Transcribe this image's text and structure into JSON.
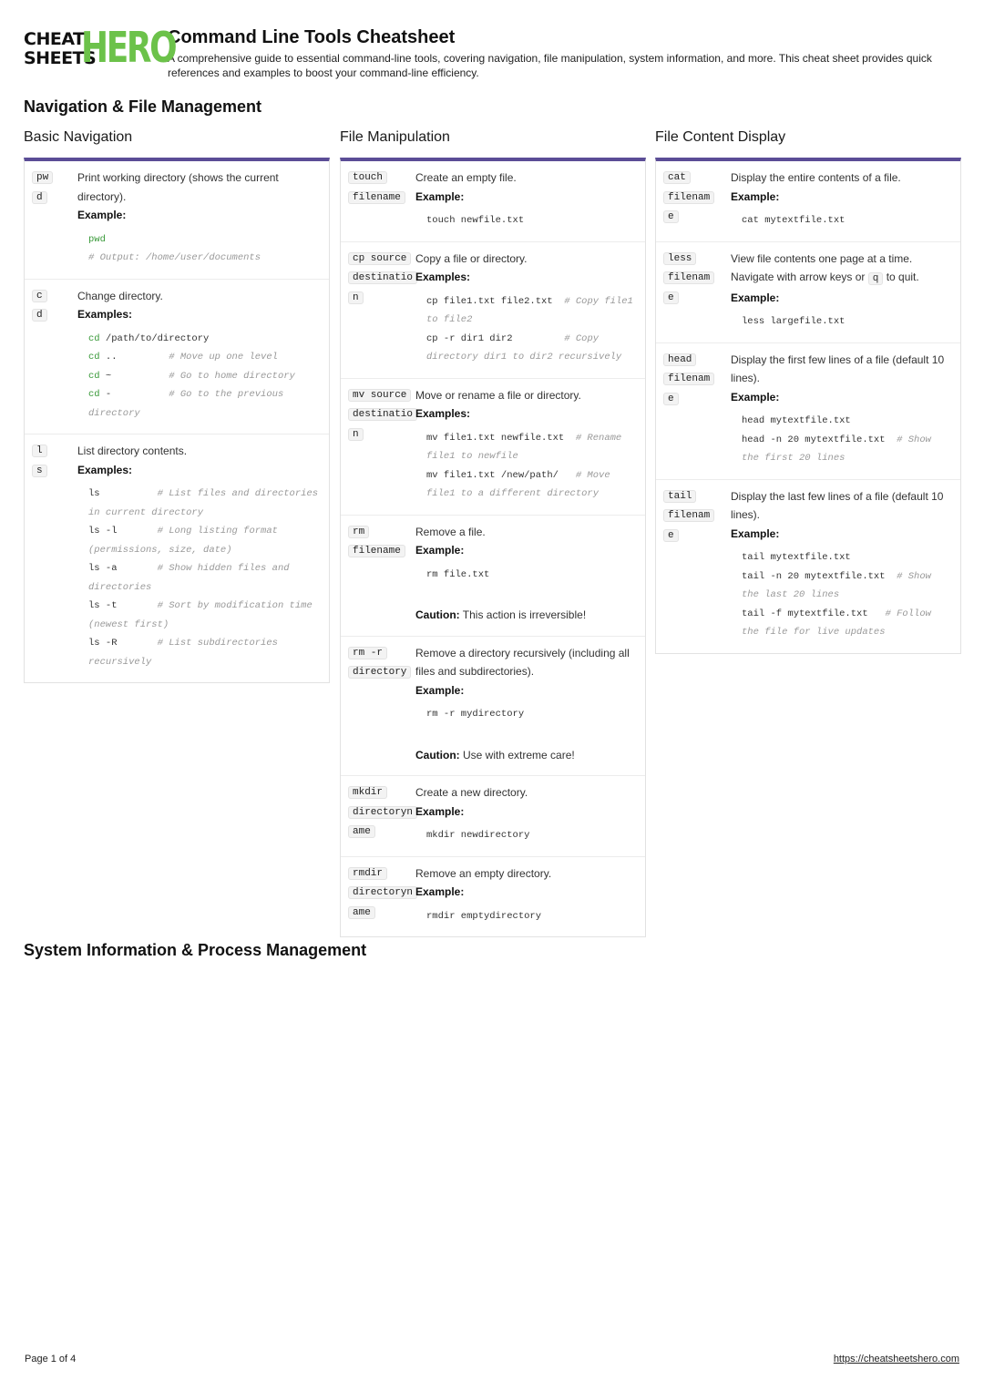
{
  "logo": {
    "line1": "CHEAT",
    "line2": "SHEETS",
    "hero": "HERO"
  },
  "header": {
    "title": "Command Line Tools Cheatsheet",
    "description": "A comprehensive guide to essential command-line tools, covering navigation, file manipulation, system information, and more. This cheat sheet provides quick references and examples to boost your command-line efficiency."
  },
  "sections": [
    {
      "title": "Navigation & File Management"
    },
    {
      "title": "System Information & Process Management"
    }
  ],
  "columns": [
    {
      "title": "Basic Navigation",
      "rows": [
        {
          "cmd_lines": [
            "pw",
            "d"
          ],
          "desc": "Print working directory (shows the current directory).",
          "example_label": "Example:",
          "code": [
            {
              "cmd": "pwd",
              "comment": ""
            },
            {
              "cmd": "",
              "comment": "# Output: /home/user/documents"
            }
          ]
        },
        {
          "cmd_lines": [
            "c",
            "d"
          ],
          "desc": "Change directory.",
          "example_label": "Examples:",
          "code": [
            {
              "cmd": "cd /path/to/directory",
              "comment": ""
            },
            {
              "cmd": "cd ..         ",
              "comment": "# Move up one level"
            },
            {
              "cmd": "cd ~          ",
              "comment": "# Go to home directory"
            },
            {
              "cmd": "cd -          ",
              "comment": "# Go to the previous directory"
            }
          ]
        },
        {
          "cmd_lines": [
            "l",
            "s"
          ],
          "desc": "List directory contents.",
          "example_label": "Examples:",
          "code": [
            {
              "cmd": "ls          ",
              "comment": "# List files and directories in current directory"
            },
            {
              "cmd": "ls -l       ",
              "comment": "# Long listing format (permissions, size, date)"
            },
            {
              "cmd": "ls -a       ",
              "comment": "# Show hidden files and directories"
            },
            {
              "cmd": "ls -t       ",
              "comment": "# Sort by modification time (newest first)"
            },
            {
              "cmd": "ls -R       ",
              "comment": "# List subdirectories recursively"
            }
          ]
        }
      ]
    },
    {
      "title": "File Manipulation",
      "rows": [
        {
          "cmd_lines": [
            "touch",
            "filename"
          ],
          "desc": "Create an empty file.",
          "example_label": "Example:",
          "code": [
            {
              "cmd": "touch newfile.txt",
              "comment": ""
            }
          ]
        },
        {
          "cmd_lines": [
            "cp source",
            "destinatio",
            "n"
          ],
          "desc": "Copy a file or directory.",
          "example_label": "Examples:",
          "code": [
            {
              "cmd": "cp file1.txt file2.txt  ",
              "comment": "# Copy file1 to file2"
            },
            {
              "cmd": "cp -r dir1 dir2         ",
              "comment": "# Copy directory dir1 to dir2 recursively"
            }
          ]
        },
        {
          "cmd_lines": [
            "mv source",
            "destinatio",
            "n"
          ],
          "desc": "Move or rename a file or directory.",
          "example_label": "Examples:",
          "code": [
            {
              "cmd": "mv file1.txt newfile.txt  ",
              "comment": "# Rename file1 to newfile"
            },
            {
              "cmd": "mv file1.txt /new/path/   ",
              "comment": "# Move file1 to a different directory"
            }
          ]
        },
        {
          "cmd_lines": [
            "rm",
            "filename"
          ],
          "desc": "Remove a file.",
          "example_label": "Example:",
          "code": [
            {
              "cmd": "rm file.txt",
              "comment": ""
            }
          ],
          "caution_label": "Caution:",
          "caution_text": "This action is irreversible!"
        },
        {
          "cmd_lines": [
            "rm -r",
            "directory"
          ],
          "desc": "Remove a directory recursively (including all files and subdirectories).",
          "example_label": "Example:",
          "code": [
            {
              "cmd": "rm -r mydirectory",
              "comment": ""
            }
          ],
          "caution_label": "Caution:",
          "caution_text": "Use with extreme care!"
        },
        {
          "cmd_lines": [
            "mkdir",
            "directoryn",
            "ame"
          ],
          "desc": "Create a new directory.",
          "example_label": "Example:",
          "code": [
            {
              "cmd": "mkdir newdirectory",
              "comment": ""
            }
          ]
        },
        {
          "cmd_lines": [
            "rmdir",
            "directoryn",
            "ame"
          ],
          "desc": "Remove an empty directory.",
          "example_label": "Example:",
          "code": [
            {
              "cmd": "rmdir emptydirectory",
              "comment": ""
            }
          ]
        }
      ]
    },
    {
      "title": "File Content Display",
      "rows": [
        {
          "cmd_lines": [
            "cat",
            "filenam",
            "e"
          ],
          "desc": "Display the entire contents of a file.",
          "example_label": "Example:",
          "code": [
            {
              "cmd": "cat mytextfile.txt",
              "comment": ""
            }
          ]
        },
        {
          "cmd_lines": [
            "less",
            "filenam",
            "e"
          ],
          "desc_before_key": "View file contents one page at a time. Navigate with arrow keys or",
          "inline_key": "q",
          "desc_after_key": "to quit.",
          "example_label": "Example:",
          "code": [
            {
              "cmd": "less largefile.txt",
              "comment": ""
            }
          ]
        },
        {
          "cmd_lines": [
            "head",
            "filenam",
            "e"
          ],
          "desc": "Display the first few lines of a file (default 10 lines).",
          "example_label": "Example:",
          "code": [
            {
              "cmd": "head mytextfile.txt",
              "comment": ""
            },
            {
              "cmd": "head -n 20 mytextfile.txt  ",
              "comment": "# Show the first 20 lines"
            }
          ]
        },
        {
          "cmd_lines": [
            "tail",
            "filenam",
            "e"
          ],
          "desc": "Display the last few lines of a file (default 10 lines).",
          "example_label": "Example:",
          "code": [
            {
              "cmd": "tail mytextfile.txt",
              "comment": ""
            },
            {
              "cmd": "tail -n 20 mytextfile.txt  ",
              "comment": "# Show the last 20 lines"
            },
            {
              "cmd": "tail -f mytextfile.txt   ",
              "comment": "# Follow the file for live updates"
            }
          ]
        }
      ]
    }
  ],
  "footer": {
    "page": "Page 1 of 4",
    "link": "https://cheatsheetshero.com"
  },
  "colors": {
    "accent": "#5b4d96",
    "brand_green": "#6cc24a",
    "code_keyword": "#3a9a3a",
    "comment": "#999999"
  }
}
